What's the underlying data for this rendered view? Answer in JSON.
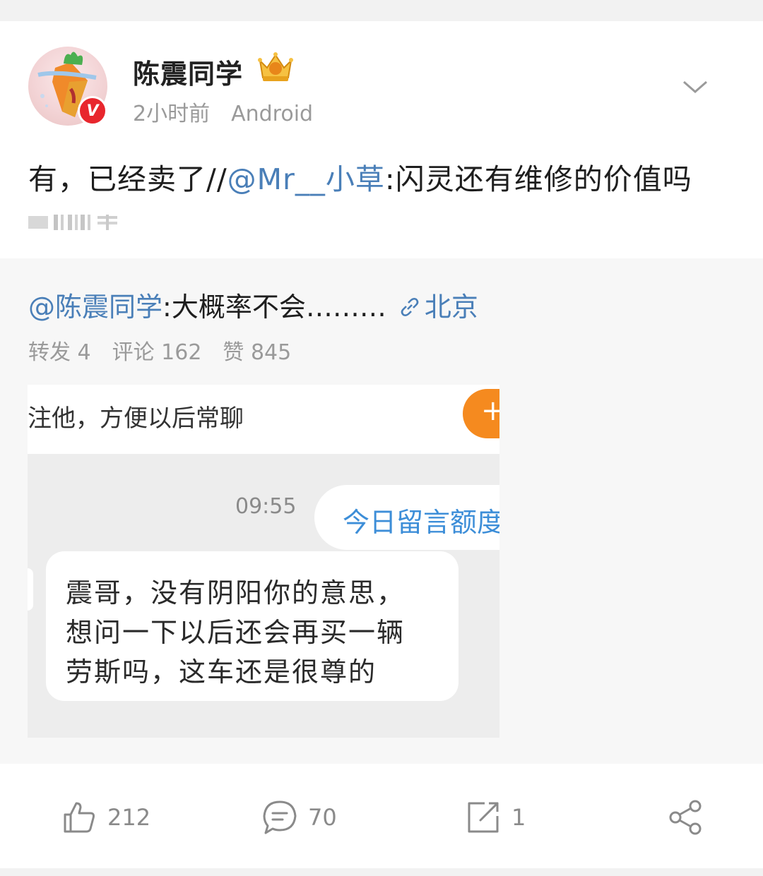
{
  "post": {
    "username": "陈震同学",
    "time": "2小时前",
    "source": "Android",
    "text_prefix": "有，已经卖了//",
    "mention": "@Mr__小草",
    "text_suffix": ":闪灵还有维修的价值吗",
    "verified_badge": "V"
  },
  "repost": {
    "mention": "@陈震同学",
    "text": ":大概率不会………",
    "location": "北京",
    "stats": {
      "forward": "转发 4",
      "comment": "评论 162",
      "like": "赞 845"
    },
    "screenshot": {
      "top_text": "注他，方便以后常聊",
      "follow_symbol": "+",
      "time": "09:55",
      "right_bubble": "今日留言额度",
      "left_bubble_lines": [
        "震哥，没有阴阳你的意思，",
        "想问一下以后还会再买一辆",
        "劳斯吗，这车还是很尊的"
      ]
    }
  },
  "actions": {
    "like_count": "212",
    "comment_count": "70",
    "share_count": "1"
  },
  "colors": {
    "link": "#4a7fb8",
    "badge_red": "#e8262d",
    "follow_orange": "#f58a1f",
    "chat_blue": "#3d8ed8"
  },
  "icons": [
    "chevron-down-icon",
    "crown-icon",
    "link-icon",
    "like-icon",
    "comment-icon",
    "share-icon",
    "more-share-icon"
  ]
}
